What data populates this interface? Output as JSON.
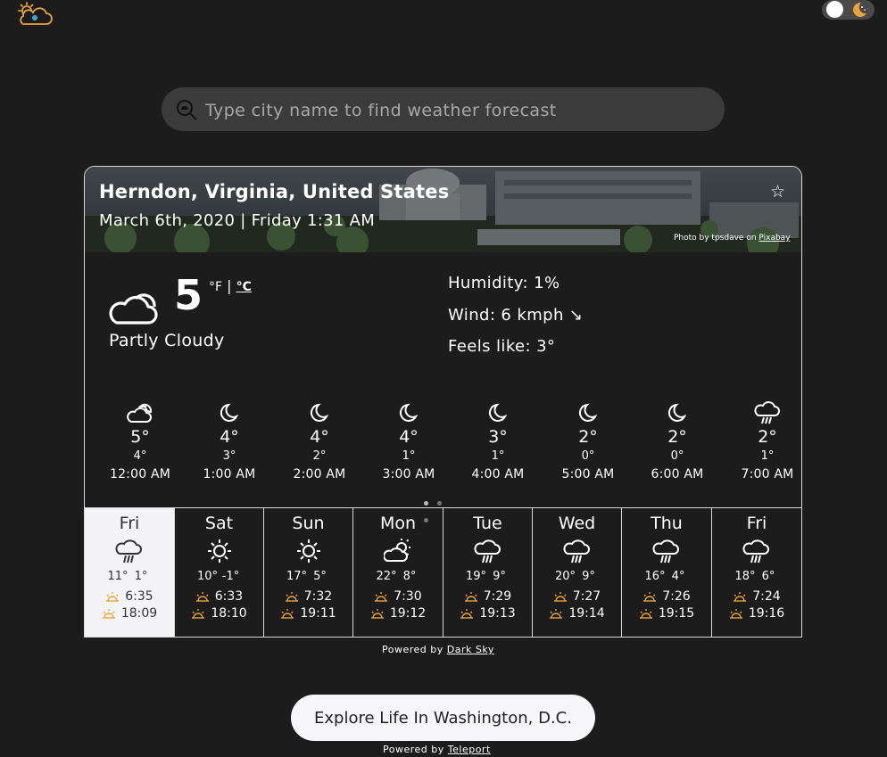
{
  "search": {
    "placeholder": "Type city name to find weather forecast"
  },
  "header": {
    "logo_icon": "sun-cloud-logo-icon",
    "theme_toggle_icon": "moon-icon"
  },
  "location": {
    "name": "Herndon, Virginia, United States",
    "datetime": "March 6th, 2020 | Friday 1:31 AM",
    "favorite_icon": "star-icon",
    "photo_credit_prefix": "Photo by tpsdave on ",
    "photo_credit_link": "Pixabay"
  },
  "current": {
    "temp": "5",
    "unit_f": "°F",
    "unit_sep": "|",
    "unit_c": "°C",
    "summary": "Partly Cloudy",
    "icon": "partly-cloudy-icon",
    "humidity": "Humidity: 1%",
    "wind": "Wind: 6 kmph ↘",
    "feels_like": "Feels like: 3°"
  },
  "hourly": [
    {
      "temp": "5°",
      "low": "4°",
      "time": "12:00 AM",
      "icon": "cloudy-moon-icon"
    },
    {
      "temp": "4°",
      "low": "3°",
      "time": "1:00 AM",
      "icon": "moon-icon"
    },
    {
      "temp": "4°",
      "low": "2°",
      "time": "2:00 AM",
      "icon": "moon-icon"
    },
    {
      "temp": "4°",
      "low": "1°",
      "time": "3:00 AM",
      "icon": "moon-icon"
    },
    {
      "temp": "3°",
      "low": "1°",
      "time": "4:00 AM",
      "icon": "moon-icon"
    },
    {
      "temp": "2°",
      "low": "0°",
      "time": "5:00 AM",
      "icon": "moon-icon"
    },
    {
      "temp": "2°",
      "low": "0°",
      "time": "6:00 AM",
      "icon": "moon-icon"
    },
    {
      "temp": "2°",
      "low": "1°",
      "time": "7:00 AM",
      "icon": "rain-icon"
    }
  ],
  "daily": [
    {
      "day": "Fri",
      "high": "11°",
      "low": "1°",
      "sunrise": "6:35",
      "sunset": "18:09",
      "icon": "rain-icon"
    },
    {
      "day": "Sat",
      "high": "10°",
      "low": "-1°",
      "sunrise": "6:33",
      "sunset": "18:10",
      "icon": "sun-icon"
    },
    {
      "day": "Sun",
      "high": "17°",
      "low": "5°",
      "sunrise": "7:32",
      "sunset": "19:11",
      "icon": "sun-icon"
    },
    {
      "day": "Mon",
      "high": "22°",
      "low": "8°",
      "sunrise": "7:30",
      "sunset": "19:12",
      "icon": "partly-cloudy-icon"
    },
    {
      "day": "Tue",
      "high": "19°",
      "low": "9°",
      "sunrise": "7:29",
      "sunset": "19:13",
      "icon": "rain-icon"
    },
    {
      "day": "Wed",
      "high": "20°",
      "low": "9°",
      "sunrise": "7:27",
      "sunset": "19:14",
      "icon": "rain-icon"
    },
    {
      "day": "Thu",
      "high": "16°",
      "low": "4°",
      "sunrise": "7:26",
      "sunset": "19:15",
      "icon": "rain-icon"
    },
    {
      "day": "Fri",
      "high": "18°",
      "low": "6°",
      "sunrise": "7:24",
      "sunset": "19:16",
      "icon": "rain-icon"
    }
  ],
  "footer": {
    "powered_prefix": "Powered by ",
    "darksky_link": "Dark Sky",
    "explore_button": "Explore Life In Washington, D.C.",
    "teleport_link": "Teleport"
  },
  "colors": {
    "background": "#1c1c1c",
    "accent": "#e8a33d",
    "selected_day": "#f4f4f6"
  }
}
